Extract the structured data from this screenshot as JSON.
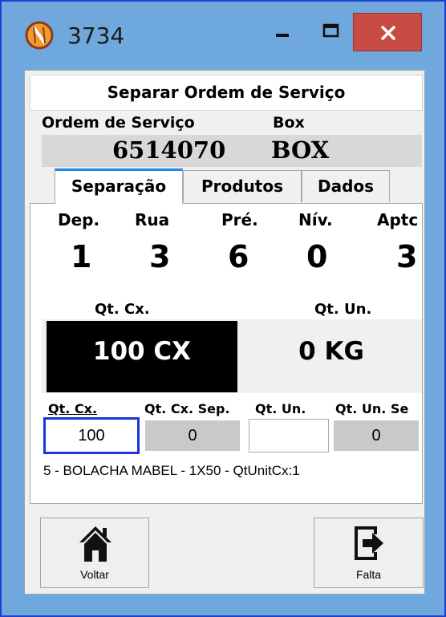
{
  "window": {
    "title": "3734"
  },
  "screen": {
    "title": "Separar Ordem de Serviço"
  },
  "ordem": {
    "label": "Ordem de Serviço",
    "value": "6514070"
  },
  "box": {
    "label": "Box",
    "value": "BOX"
  },
  "tabs": [
    {
      "label": "Separação",
      "active": true
    },
    {
      "label": "Produtos",
      "active": false
    },
    {
      "label": "Dados",
      "active": false
    }
  ],
  "location": {
    "headers": [
      "Dep.",
      "Rua",
      "Pré.",
      "Nív.",
      "Aptc"
    ],
    "values": [
      "1",
      "3",
      "6",
      "0",
      "3"
    ]
  },
  "quantities": {
    "qt_cx_label": "Qt. Cx.",
    "qt_un_label": "Qt. Un.",
    "qt_cx_value": "100 CX",
    "qt_un_value": "0 KG"
  },
  "entry": {
    "headers": [
      "Qt. Cx.",
      "Qt. Cx. Sep.",
      "Qt. Un.",
      "Qt. Un. Se"
    ],
    "qt_cx_input": "100",
    "qt_cx_sep": "0",
    "qt_un_input": "",
    "qt_un_sep": "0"
  },
  "product": {
    "description": "5 - BOLACHA MABEL - 1X50 - QtUnitCx:1"
  },
  "buttons": {
    "voltar": "Voltar",
    "falta": "Falta"
  },
  "colors": {
    "accent_blue": "#1b36d8",
    "close_red": "#c94b46",
    "titlebar": "#6fa8dc"
  }
}
